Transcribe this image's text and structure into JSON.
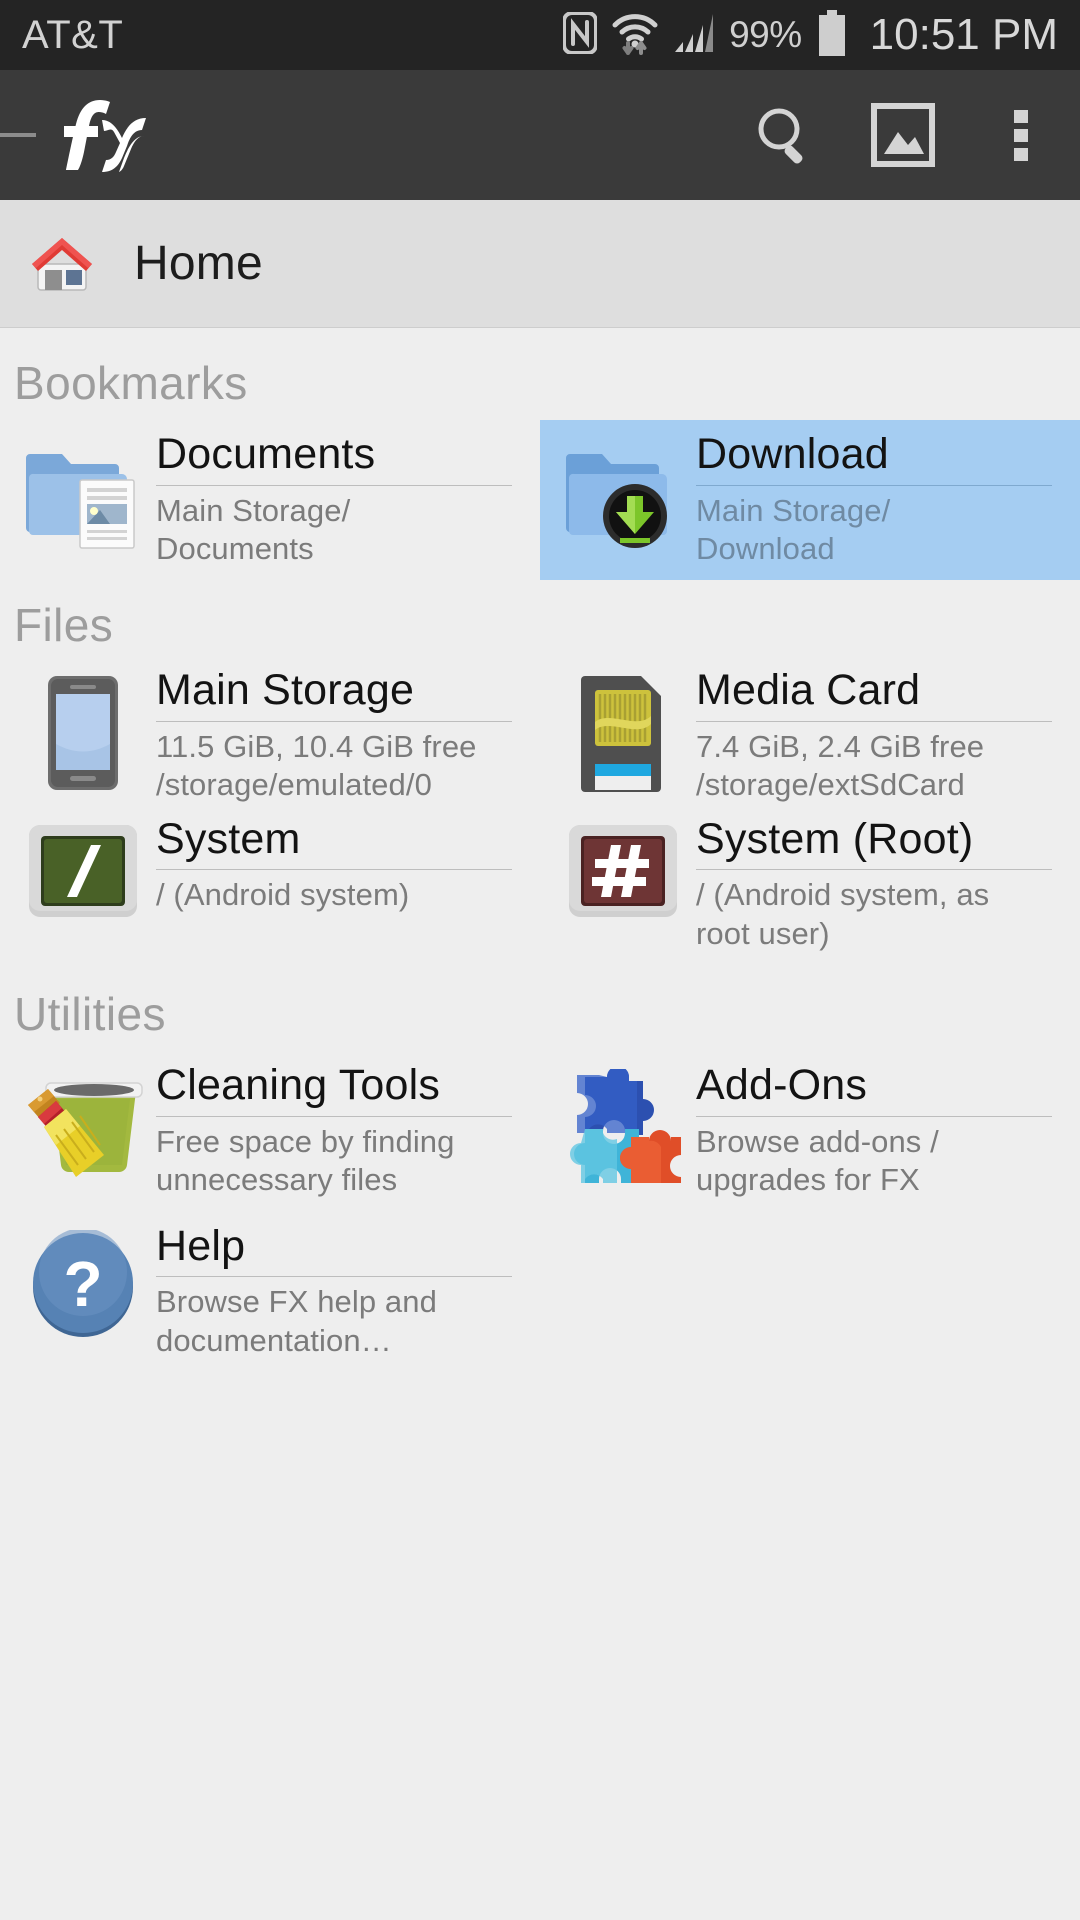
{
  "status_bar": {
    "carrier": "AT&T",
    "battery_percent": "99%",
    "time": "10:51 PM",
    "icons": [
      "nfc-icon",
      "wifi-icon",
      "cellular-signal-icon",
      "battery-icon"
    ]
  },
  "app_bar": {
    "app_name": "FX",
    "drag_handle": "drawer-handle",
    "actions": [
      {
        "name": "search-button",
        "icon": "search-icon"
      },
      {
        "name": "gallery-button",
        "icon": "image-icon"
      },
      {
        "name": "overflow-menu-button",
        "icon": "more-vertical-icon"
      }
    ]
  },
  "path_bar": {
    "icon": "home-icon",
    "label": "Home"
  },
  "sections": [
    {
      "id": "bookmarks",
      "header": "Bookmarks",
      "items": [
        {
          "title": "Documents",
          "subtitle": "Main Storage/\nDocuments",
          "subtitle_line1": "Main Storage/",
          "subtitle_line2": "Documents",
          "icon": "folder-documents-icon",
          "selected": false
        },
        {
          "title": "Download",
          "subtitle": "Main Storage/\nDownload",
          "subtitle_line1": "Main Storage/",
          "subtitle_line2": "Download",
          "icon": "folder-download-icon",
          "selected": true
        }
      ]
    },
    {
      "id": "files",
      "header": "Files",
      "items": [
        {
          "title": "Main Storage",
          "subtitle_line1": "11.5 GiB, 10.4 GiB free",
          "subtitle_line2": "/storage/emulated/0",
          "icon": "phone-storage-icon",
          "selected": false
        },
        {
          "title": "Media Card",
          "subtitle_line1": "7.4 GiB, 2.4 GiB free",
          "subtitle_line2": "/storage/extSdCard",
          "icon": "sd-card-icon",
          "selected": false
        },
        {
          "title": "System",
          "subtitle_line1": "/ (Android system)",
          "subtitle_line2": "",
          "icon": "terminal-slash-icon",
          "selected": false
        },
        {
          "title": "System (Root)",
          "subtitle_line1": "/ (Android system, as",
          "subtitle_line2": "root user)",
          "icon": "terminal-hash-icon",
          "selected": false
        }
      ]
    },
    {
      "id": "utilities",
      "header": "Utilities",
      "items": [
        {
          "title": "Cleaning Tools",
          "subtitle_line1": "Free space by finding",
          "subtitle_line2": "unnecessary files",
          "icon": "broom-bucket-icon",
          "selected": false
        },
        {
          "title": "Add-Ons",
          "subtitle_line1": "Browse add-ons /",
          "subtitle_line2": "upgrades for FX",
          "icon": "puzzle-pieces-icon",
          "selected": false
        },
        {
          "title": "Help",
          "subtitle_line1": "Browse FX help and",
          "subtitle_line2": "documentation…",
          "icon": "help-question-icon",
          "selected": false
        }
      ]
    }
  ],
  "colors": {
    "status_bar_bg": "#242424",
    "app_bar_bg": "#3a3a3a",
    "path_bar_bg": "#dedede",
    "content_bg": "#eeeeee",
    "selection_highlight": "#a5cdf2",
    "title_text": "#131313",
    "subtitle_text": "#7b7b7b",
    "section_header_text": "#9d9d9d"
  }
}
